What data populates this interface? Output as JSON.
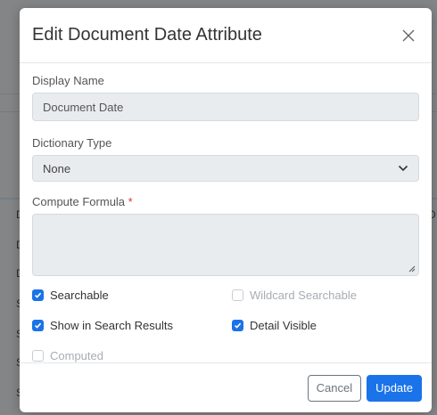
{
  "modal": {
    "title": "Edit Document Date Attribute",
    "close_icon": "close-icon"
  },
  "form": {
    "display_name_label": "Display Name",
    "display_name_value": "Document Date",
    "dictionary_type_label": "Dictionary Type",
    "dictionary_type_value": "None",
    "compute_formula_label": "Compute Formula",
    "required_marker": "*",
    "compute_formula_value": ""
  },
  "checkboxes": [
    {
      "label": "Searchable",
      "checked": true,
      "disabled": false
    },
    {
      "label": "Wildcard Searchable",
      "checked": false,
      "disabled": true
    },
    {
      "label": "Show in Search Results",
      "checked": true,
      "disabled": false
    },
    {
      "label": "Detail Visible",
      "checked": true,
      "disabled": false
    },
    {
      "label": "Computed",
      "checked": false,
      "disabled": true
    }
  ],
  "footer": {
    "cancel_label": "Cancel",
    "update_label": "Update"
  },
  "colors": {
    "primary": "#1a73e8",
    "required": "#dc3545"
  }
}
